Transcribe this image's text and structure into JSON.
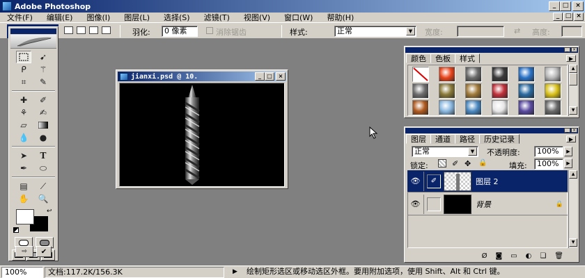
{
  "app": {
    "title": "Adobe Photoshop"
  },
  "window_buttons": {
    "minimize": "_",
    "maximize": "□",
    "close": "×"
  },
  "menubar": {
    "items": [
      {
        "label": "文件(F)"
      },
      {
        "label": "编辑(E)"
      },
      {
        "label": "图像(I)"
      },
      {
        "label": "图层(L)"
      },
      {
        "label": "选择(S)"
      },
      {
        "label": "滤镜(T)"
      },
      {
        "label": "视图(V)"
      },
      {
        "label": "窗口(W)"
      },
      {
        "label": "帮助(H)"
      }
    ]
  },
  "options_bar": {
    "feather_label": "羽化:",
    "feather_value": "0 像素",
    "antialias_label": "消除锯齿",
    "style_label": "样式:",
    "style_value": "正常",
    "width_label": "宽度:",
    "height_label": "高度:",
    "swap_icon": "⇄"
  },
  "document": {
    "title": "jianxi.psd @ 10."
  },
  "styles_palette": {
    "tabs": [
      {
        "label": "颜色"
      },
      {
        "label": "色板"
      },
      {
        "label": "样式"
      }
    ],
    "active_tab": "样式",
    "swatch_colors": [
      "#ffffff",
      "#e8441a",
      "#6b6b6b",
      "#3a3a3a",
      "#2a72c6",
      "#b8b8b8",
      "#6e6e6e",
      "#8a7a3a",
      "#a07a3a",
      "#c0303a",
      "#2a6aa0",
      "#d8c018",
      "#b05a20",
      "#8ab8e0",
      "#4a88c0",
      "#e6e6e6",
      "#5a4aa0",
      "#6a6a6a"
    ]
  },
  "layers_palette": {
    "tabs": [
      {
        "label": "图层"
      },
      {
        "label": "通道"
      },
      {
        "label": "路径"
      },
      {
        "label": "历史记录"
      }
    ],
    "blend_mode": "正常",
    "opacity_label": "不透明度:",
    "opacity_value": "100%",
    "lock_label": "锁定:",
    "fill_label": "填充:",
    "fill_value": "100%",
    "layers": [
      {
        "name": "图层 2",
        "selected": true
      },
      {
        "name": "背景",
        "selected": false,
        "italic": true
      }
    ]
  },
  "status_bar": {
    "zoom": "100%",
    "doc_info": "文档:117.2K/156.3K",
    "hint": "绘制矩形选区或移动选区外框。要用附加选项，使用 Shift、Alt 和 Ctrl 键。"
  },
  "colors": {
    "title_gradient_start": "#0a246a",
    "title_gradient_end": "#a6caf0",
    "workspace": "#808080",
    "chrome": "#d4d0c8",
    "foreground_swatch": "#ffffff",
    "background_swatch": "#000000"
  }
}
